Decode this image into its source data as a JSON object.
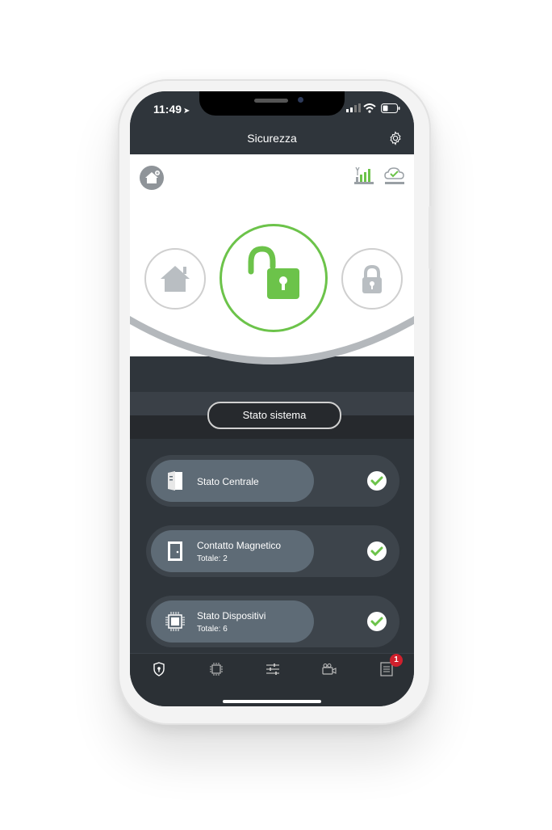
{
  "status_bar": {
    "time": "11:49",
    "arrow": "➤"
  },
  "header": {
    "title": "Sicurezza",
    "settings_icon": "gear-icon"
  },
  "top_area": {
    "left_icon": "home-badge-icon",
    "right_icons": [
      "signal-strength-icon",
      "cloud-check-icon"
    ]
  },
  "modes": {
    "home": {
      "icon": "home-icon",
      "state": "inactive"
    },
    "main": {
      "icon": "unlocked-padlock-icon",
      "state": "active"
    },
    "lock": {
      "icon": "locked-padlock-icon",
      "state": "inactive"
    }
  },
  "system": {
    "button_label": "Stato sistema"
  },
  "cards": [
    {
      "title": "Stato Centrale",
      "subtitle": "",
      "icon": "control-panel-icon",
      "status": "ok"
    },
    {
      "title": "Contatto Magnetico",
      "subtitle": "Totale: 2",
      "icon": "door-icon",
      "status": "ok"
    },
    {
      "title": "Stato Dispositivi",
      "subtitle": "Totale: 6",
      "icon": "chip-icon",
      "status": "ok"
    }
  ],
  "tabbar": {
    "tabs": [
      "shield-icon",
      "chip-icon",
      "sliders-icon",
      "camera-icon",
      "list-icon"
    ],
    "badge_count": "1"
  },
  "colors": {
    "accent_green": "#6cc34a",
    "dark_bg": "#2f353b",
    "pill": "#5e6b76",
    "badge_red": "#d0202d"
  }
}
